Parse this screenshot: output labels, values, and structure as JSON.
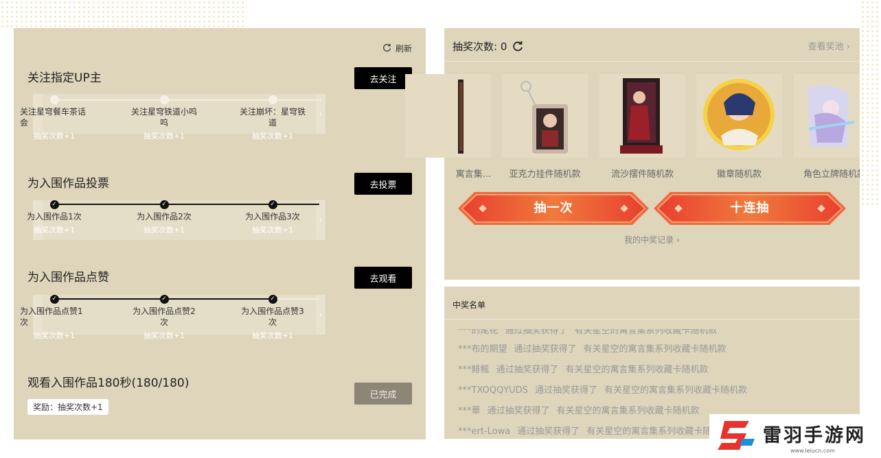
{
  "refresh": {
    "label": "刷新"
  },
  "tasks": [
    {
      "title": "关注指定UP主",
      "button": "去关注",
      "nodes": [
        {
          "label": "关注星穹餐车茶话会",
          "sub": "抽奖次数+1"
        },
        {
          "label": "关注星穹铁道小呜呜",
          "sub": "抽奖次数+1"
        },
        {
          "label": "关注崩坏：星穹铁道",
          "sub": "抽奖次数+1"
        }
      ]
    },
    {
      "title": "为入围作品投票",
      "button": "去投票",
      "nodes": [
        {
          "label": "为入围作品1次",
          "sub": "抽奖次数+1"
        },
        {
          "label": "为入围作品2次",
          "sub": "抽奖次数+1"
        },
        {
          "label": "为入围作品3次",
          "sub": "抽奖次数+1"
        }
      ]
    },
    {
      "title": "为入围作品点赞",
      "button": "去观看",
      "nodes": [
        {
          "label": "为入围作品点赞1次",
          "sub": "抽奖次数+1"
        },
        {
          "label": "为入围作品点赞2次",
          "sub": "抽奖次数+1"
        },
        {
          "label": "为入围作品点赞3次",
          "sub": "抽奖次数+1"
        }
      ]
    },
    {
      "title": "观看入围作品180秒(180/180)",
      "button": "已完成",
      "reward": "奖励：抽奖次数+1"
    }
  ],
  "lottery": {
    "count_label": "抽奖次数: 0",
    "pool_link": "查看奖池",
    "prizes": [
      "寓言集...",
      "亚克力挂件随机款",
      "流沙摆件随机款",
      "徽章随机款",
      "角色立牌随机款"
    ],
    "draw_once": "抽一次",
    "draw_ten": "十连抽",
    "my_record": "我的中奖记录"
  },
  "winners": {
    "title": "中奖名单",
    "items": [
      {
        "user": "***的尾花",
        "action": "通过抽奖获得了",
        "prize": "有关星空的寓言集系列收藏卡随机款"
      },
      {
        "user": "***布的期望",
        "action": "通过抽奖获得了",
        "prize": "有关星空的寓言集系列收藏卡随机款"
      },
      {
        "user": "***鲱鲺",
        "action": "通过抽奖获得了",
        "prize": "有关星空的寓言集系列收藏卡随机款"
      },
      {
        "user": "***TXOQQYUDS",
        "action": "通过抽奖获得了",
        "prize": "有关星空的寓言集系列收藏卡随机款"
      },
      {
        "user": "***華",
        "action": "通过抽奖获得了",
        "prize": "有关星空的寓言集系列收藏卡随机款"
      },
      {
        "user": "***ert-Lowa",
        "action": "通过抽奖获得了",
        "prize": "有关星空的寓言集系列收藏卡随机款"
      }
    ]
  },
  "watermark": {
    "name": "雷羽手游网",
    "url": "www.leiucn.com"
  }
}
